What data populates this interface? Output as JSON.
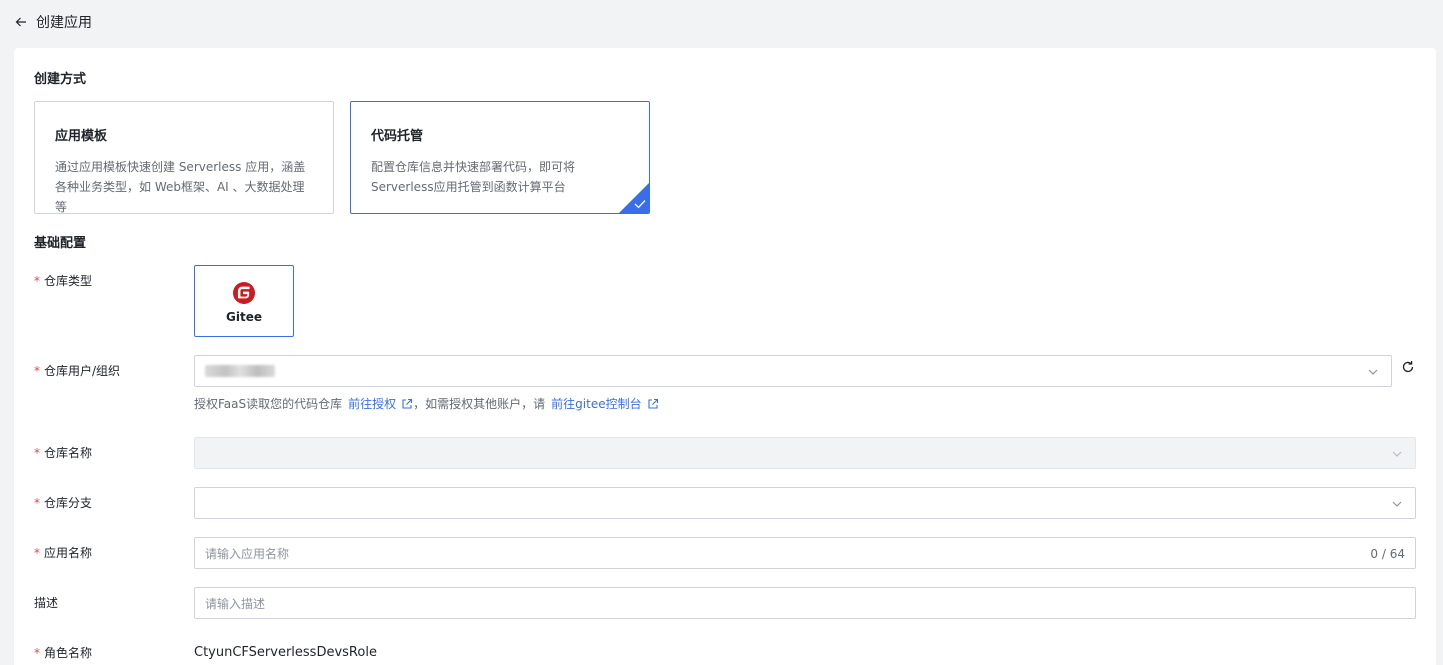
{
  "header": {
    "title": "创建应用"
  },
  "creation": {
    "section_title": "创建方式",
    "options": [
      {
        "title": "应用模板",
        "desc": "通过应用模板快速创建 Serverless 应用，涵盖各种业务类型，如 Web框架、AI 、大数据处理 等"
      },
      {
        "title": "代码托管",
        "desc": "配置仓库信息并快速部署代码，即可将Serverless应用托管到函数计算平台"
      }
    ]
  },
  "basic": {
    "section_title": "基础配置",
    "repo_type": {
      "label": "仓库类型",
      "option": "Gitee"
    },
    "repo_user": {
      "label": "仓库用户/组织",
      "hint_prefix": "授权FaaS读取您的代码仓库",
      "auth_link": "前往授权",
      "hint_middle": "，如需授权其他账户，请",
      "console_link": "前往gitee控制台"
    },
    "repo_name": {
      "label": "仓库名称"
    },
    "repo_branch": {
      "label": "仓库分支"
    },
    "app_name": {
      "label": "应用名称",
      "placeholder": "请输入应用名称",
      "counter": "0 / 64"
    },
    "description": {
      "label": "描述",
      "placeholder": "请输入描述"
    },
    "role": {
      "label": "角色名称",
      "value": "CtyunCFServerlessDevsRole"
    }
  },
  "colors": {
    "accent": "#3a6ee8",
    "required": "#e54545",
    "gitee_red": "#c71d23"
  }
}
